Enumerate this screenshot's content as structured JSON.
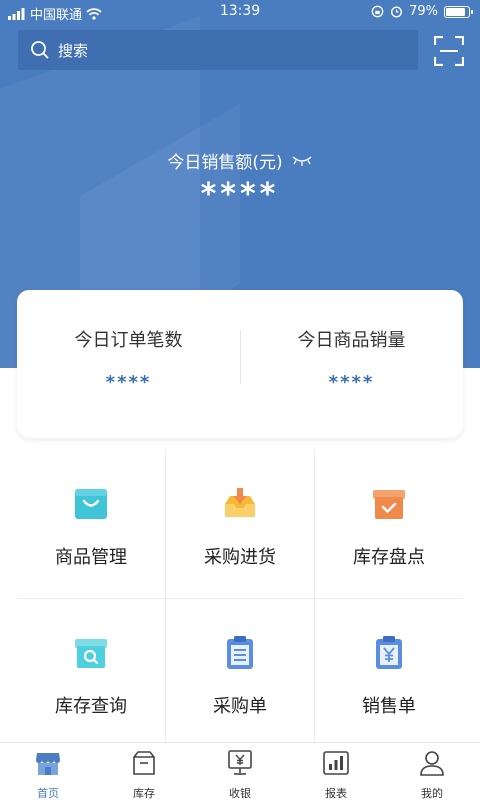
{
  "status_bar": {
    "carrier": "中国联通",
    "time": "13:39",
    "battery": "79%",
    "battery_level": 0.79
  },
  "search": {
    "placeholder": "搜索",
    "icon": "search-icon",
    "scan_icon": "scan-icon"
  },
  "sales": {
    "label": "今日销售额(元)",
    "value": "****",
    "toggle_icon": "eye-closed-icon"
  },
  "stats": {
    "orders_label": "今日订单笔数",
    "orders_value": "****",
    "units_label": "今日商品销量",
    "units_value": "****"
  },
  "features": [
    {
      "label": "商品管理",
      "icon": "shopping-bag-icon",
      "color": "#3fc4d8"
    },
    {
      "label": "采购进货",
      "icon": "inbox-download-icon",
      "color": "#f6b935"
    },
    {
      "label": "库存盘点",
      "icon": "box-check-icon",
      "color": "#f08a4b"
    },
    {
      "label": "库存查询",
      "icon": "box-search-icon",
      "color": "#4fd0df"
    },
    {
      "label": "采购单",
      "icon": "clipboard-list-icon",
      "color": "#5b8ee0"
    },
    {
      "label": "销售单",
      "icon": "clipboard-yen-icon",
      "color": "#5b8ee0"
    }
  ],
  "tabs": [
    {
      "label": "首页",
      "icon": "shop-icon",
      "active": true
    },
    {
      "label": "库存",
      "icon": "box-icon",
      "active": false
    },
    {
      "label": "收银",
      "icon": "cashier-icon",
      "active": false
    },
    {
      "label": "报表",
      "icon": "chart-icon",
      "active": false
    },
    {
      "label": "我的",
      "icon": "user-icon",
      "active": false
    }
  ],
  "colors": {
    "brand": "#4a7cc0",
    "accent_text": "#3a6fb5"
  }
}
